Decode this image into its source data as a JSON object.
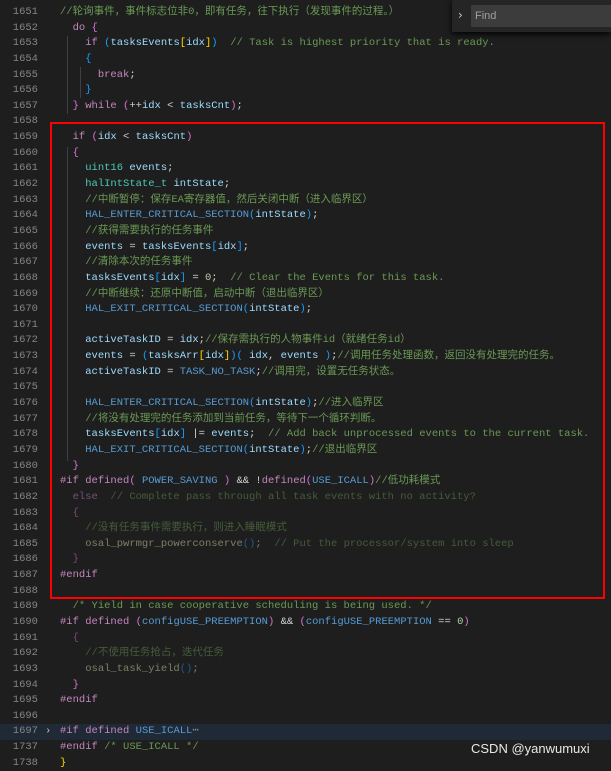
{
  "find_widget": {
    "placeholder": "Find"
  },
  "watermark": "CSDN @yanwumuxi",
  "lines": [
    {
      "n": "1651",
      "t": [
        [
          "c",
          "//轮询事件，事件标志位非0，即有任务，往下执行（发现事件的过程。）"
        ]
      ]
    },
    {
      "n": "1652",
      "t": [
        [
          "p",
          "  "
        ],
        [
          "k",
          "do "
        ],
        [
          "b2",
          "{"
        ]
      ]
    },
    {
      "n": "1653",
      "t": [
        [
          "p",
          "    "
        ],
        [
          "k",
          "if "
        ],
        [
          "b3",
          "("
        ],
        [
          "v",
          "tasksEvents"
        ],
        [
          "b1",
          "["
        ],
        [
          "v",
          "idx"
        ],
        [
          "b1",
          "]"
        ],
        [
          "b3",
          ")"
        ],
        [
          "p",
          "  "
        ],
        [
          "c",
          "// Task is highest priority that is ready."
        ]
      ]
    },
    {
      "n": "1654",
      "t": [
        [
          "p",
          "    "
        ],
        [
          "b3",
          "{"
        ]
      ]
    },
    {
      "n": "1655",
      "t": [
        [
          "p",
          "      "
        ],
        [
          "k",
          "break"
        ],
        [
          "p",
          ";"
        ]
      ]
    },
    {
      "n": "1656",
      "t": [
        [
          "p",
          "    "
        ],
        [
          "b3",
          "}"
        ]
      ]
    },
    {
      "n": "1657",
      "t": [
        [
          "p",
          "  "
        ],
        [
          "b2",
          "} "
        ],
        [
          "k",
          "while "
        ],
        [
          "b2",
          "("
        ],
        [
          "p",
          "++"
        ],
        [
          "v",
          "idx"
        ],
        [
          "p",
          " < "
        ],
        [
          "v",
          "tasksCnt"
        ],
        [
          "b2",
          ")"
        ],
        [
          "p",
          ";"
        ]
      ]
    },
    {
      "n": "1658",
      "t": []
    },
    {
      "n": "1659",
      "t": [
        [
          "p",
          "  "
        ],
        [
          "k",
          "if "
        ],
        [
          "b2",
          "("
        ],
        [
          "v",
          "idx"
        ],
        [
          "p",
          " < "
        ],
        [
          "v",
          "tasksCnt"
        ],
        [
          "b2",
          ")"
        ]
      ]
    },
    {
      "n": "1660",
      "t": [
        [
          "p",
          "  "
        ],
        [
          "b2",
          "{"
        ]
      ]
    },
    {
      "n": "1661",
      "t": [
        [
          "p",
          "    "
        ],
        [
          "ty",
          "uint16 "
        ],
        [
          "v",
          "events"
        ],
        [
          "p",
          ";"
        ]
      ]
    },
    {
      "n": "1662",
      "t": [
        [
          "p",
          "    "
        ],
        [
          "ty",
          "halIntState_t "
        ],
        [
          "v",
          "intState"
        ],
        [
          "p",
          ";"
        ]
      ]
    },
    {
      "n": "1663",
      "t": [
        [
          "p",
          "    "
        ],
        [
          "c",
          "//中断暂停：保存EA寄存器值，然后关闭中断（进入临界区）"
        ]
      ]
    },
    {
      "n": "1664",
      "t": [
        [
          "p",
          "    "
        ],
        [
          "m",
          "HAL_ENTER_CRITICAL_SECTION"
        ],
        [
          "b3",
          "("
        ],
        [
          "v",
          "intState"
        ],
        [
          "b3",
          ")"
        ],
        [
          "p",
          ";"
        ]
      ]
    },
    {
      "n": "1665",
      "t": [
        [
          "p",
          "    "
        ],
        [
          "c",
          "//获得需要执行的任务事件"
        ]
      ]
    },
    {
      "n": "1666",
      "t": [
        [
          "p",
          "    "
        ],
        [
          "v",
          "events"
        ],
        [
          "p",
          " = "
        ],
        [
          "v",
          "tasksEvents"
        ],
        [
          "b3",
          "["
        ],
        [
          "v",
          "idx"
        ],
        [
          "b3",
          "]"
        ],
        [
          "p",
          ";"
        ]
      ]
    },
    {
      "n": "1667",
      "t": [
        [
          "p",
          "    "
        ],
        [
          "c",
          "//清除本次的任务事件"
        ]
      ]
    },
    {
      "n": "1668",
      "t": [
        [
          "p",
          "    "
        ],
        [
          "v",
          "tasksEvents"
        ],
        [
          "b3",
          "["
        ],
        [
          "v",
          "idx"
        ],
        [
          "b3",
          "]"
        ],
        [
          "p",
          " = "
        ],
        [
          "n",
          "0"
        ],
        [
          "p",
          ";  "
        ],
        [
          "c",
          "// Clear the Events for this task."
        ]
      ]
    },
    {
      "n": "1669",
      "t": [
        [
          "p",
          "    "
        ],
        [
          "c",
          "//中断继续：还原中断值，启动中断（退出临界区）"
        ]
      ]
    },
    {
      "n": "1670",
      "t": [
        [
          "p",
          "    "
        ],
        [
          "m",
          "HAL_EXIT_CRITICAL_SECTION"
        ],
        [
          "b3",
          "("
        ],
        [
          "v",
          "intState"
        ],
        [
          "b3",
          ")"
        ],
        [
          "p",
          ";"
        ]
      ]
    },
    {
      "n": "1671",
      "t": []
    },
    {
      "n": "1672",
      "t": [
        [
          "p",
          "    "
        ],
        [
          "v",
          "activeTaskID"
        ],
        [
          "p",
          " = "
        ],
        [
          "v",
          "idx"
        ],
        [
          "p",
          ";"
        ],
        [
          "c",
          "//保存需执行的人物事件id（就绪任务id）"
        ]
      ]
    },
    {
      "n": "1673",
      "t": [
        [
          "p",
          "    "
        ],
        [
          "v",
          "events"
        ],
        [
          "p",
          " = "
        ],
        [
          "b3",
          "("
        ],
        [
          "v",
          "tasksArr"
        ],
        [
          "b1",
          "["
        ],
        [
          "v",
          "idx"
        ],
        [
          "b1",
          "]"
        ],
        [
          "b3",
          ")"
        ],
        [
          "b3",
          "( "
        ],
        [
          "v",
          "idx"
        ],
        [
          "p",
          ", "
        ],
        [
          "v",
          "events"
        ],
        [
          "b3",
          " )"
        ],
        [
          "p",
          ";"
        ],
        [
          "c",
          "//调用任务处理函数，返回没有处理完的任务。"
        ]
      ]
    },
    {
      "n": "1674",
      "t": [
        [
          "p",
          "    "
        ],
        [
          "v",
          "activeTaskID"
        ],
        [
          "p",
          " = "
        ],
        [
          "m",
          "TASK_NO_TASK"
        ],
        [
          "p",
          ";"
        ],
        [
          "c",
          "//调用完，设置无任务状态。"
        ]
      ]
    },
    {
      "n": "1675",
      "t": []
    },
    {
      "n": "1676",
      "t": [
        [
          "p",
          "    "
        ],
        [
          "m",
          "HAL_ENTER_CRITICAL_SECTION"
        ],
        [
          "b3",
          "("
        ],
        [
          "v",
          "intState"
        ],
        [
          "b3",
          ")"
        ],
        [
          "p",
          ";"
        ],
        [
          "c",
          "//进入临界区"
        ]
      ]
    },
    {
      "n": "1677",
      "t": [
        [
          "p",
          "    "
        ],
        [
          "c",
          "//将没有处理完的任务添加到当前任务，等待下一个循环判断。"
        ]
      ]
    },
    {
      "n": "1678",
      "t": [
        [
          "p",
          "    "
        ],
        [
          "v",
          "tasksEvents"
        ],
        [
          "b3",
          "["
        ],
        [
          "v",
          "idx"
        ],
        [
          "b3",
          "]"
        ],
        [
          "p",
          " |= "
        ],
        [
          "v",
          "events"
        ],
        [
          "p",
          ";  "
        ],
        [
          "c",
          "// Add back unprocessed events to the current task."
        ]
      ]
    },
    {
      "n": "1679",
      "t": [
        [
          "p",
          "    "
        ],
        [
          "m",
          "HAL_EXIT_CRITICAL_SECTION"
        ],
        [
          "b3",
          "("
        ],
        [
          "v",
          "intState"
        ],
        [
          "b3",
          ")"
        ],
        [
          "p",
          ";"
        ],
        [
          "c",
          "//退出临界区"
        ]
      ]
    },
    {
      "n": "1680",
      "t": [
        [
          "p",
          "  "
        ],
        [
          "b2",
          "}"
        ]
      ]
    },
    {
      "n": "1681",
      "t": [
        [
          "k",
          "#if "
        ],
        [
          "k",
          "defined"
        ],
        [
          "b2",
          "( "
        ],
        [
          "m",
          "POWER_SAVING"
        ],
        [
          "b2",
          " )"
        ],
        [
          "p",
          " && !"
        ],
        [
          "k",
          "defined"
        ],
        [
          "b2",
          "("
        ],
        [
          "m",
          "USE_ICALL"
        ],
        [
          "b2",
          ")"
        ],
        [
          "c",
          "//低功耗模式"
        ]
      ]
    },
    {
      "n": "1682",
      "d": true,
      "t": [
        [
          "p",
          "  "
        ],
        [
          "k",
          "else  "
        ],
        [
          "c",
          "// Complete pass through all task events with no activity?"
        ]
      ]
    },
    {
      "n": "1683",
      "d": true,
      "t": [
        [
          "p",
          "  "
        ],
        [
          "b2",
          "{"
        ]
      ]
    },
    {
      "n": "1684",
      "d": true,
      "t": [
        [
          "p",
          "    "
        ],
        [
          "c",
          "//没有任务事件需要执行，则进入睡眠模式"
        ]
      ]
    },
    {
      "n": "1685",
      "d": true,
      "t": [
        [
          "p",
          "    "
        ],
        [
          "f",
          "osal_pwrmgr_powerconserve"
        ],
        [
          "b3",
          "()"
        ],
        [
          "p",
          ";  "
        ],
        [
          "c",
          "// Put the processor/system into sleep"
        ]
      ]
    },
    {
      "n": "1686",
      "d": true,
      "t": [
        [
          "p",
          "  "
        ],
        [
          "b2",
          "}"
        ]
      ]
    },
    {
      "n": "1687",
      "t": [
        [
          "k",
          "#endif"
        ]
      ]
    },
    {
      "n": "1688",
      "t": []
    },
    {
      "n": "1689",
      "t": [
        [
          "p",
          "  "
        ],
        [
          "c",
          "/* Yield in case cooperative scheduling is being used. */"
        ]
      ]
    },
    {
      "n": "1690",
      "t": [
        [
          "k",
          "#if "
        ],
        [
          "k",
          "defined "
        ],
        [
          "b2",
          "("
        ],
        [
          "m",
          "configUSE_PREEMPTION"
        ],
        [
          "b2",
          ")"
        ],
        [
          "p",
          " && "
        ],
        [
          "b2",
          "("
        ],
        [
          "m",
          "configUSE_PREEMPTION"
        ],
        [
          "p",
          " == "
        ],
        [
          "n",
          "0"
        ],
        [
          "b2",
          ")"
        ]
      ]
    },
    {
      "n": "1691",
      "d": true,
      "t": [
        [
          "p",
          "  "
        ],
        [
          "b2",
          "{"
        ]
      ]
    },
    {
      "n": "1692",
      "d": true,
      "t": [
        [
          "p",
          "    "
        ],
        [
          "c",
          "//不使用任务抢占，迭代任务"
        ]
      ]
    },
    {
      "n": "1693",
      "d": true,
      "t": [
        [
          "p",
          "    "
        ],
        [
          "f",
          "osal_task_yield"
        ],
        [
          "b3",
          "()"
        ],
        [
          "p",
          ";"
        ]
      ]
    },
    {
      "n": "1694",
      "t": [
        [
          "p",
          "  "
        ],
        [
          "b2",
          "}"
        ]
      ]
    },
    {
      "n": "1695",
      "t": [
        [
          "k",
          "#endif"
        ]
      ]
    },
    {
      "n": "1696",
      "t": []
    },
    {
      "n": "1697",
      "fold": true,
      "hl": true,
      "t": [
        [
          "k",
          "#if "
        ],
        [
          "k",
          "defined "
        ],
        [
          "m",
          "USE_ICALL"
        ],
        [
          "fl",
          "⋯"
        ]
      ]
    },
    {
      "n": "1737",
      "t": [
        [
          "k",
          "#endif "
        ],
        [
          "c",
          "/* USE_ICALL */"
        ]
      ]
    },
    {
      "n": "1738",
      "t": [
        [
          "b1",
          "}"
        ]
      ]
    }
  ]
}
